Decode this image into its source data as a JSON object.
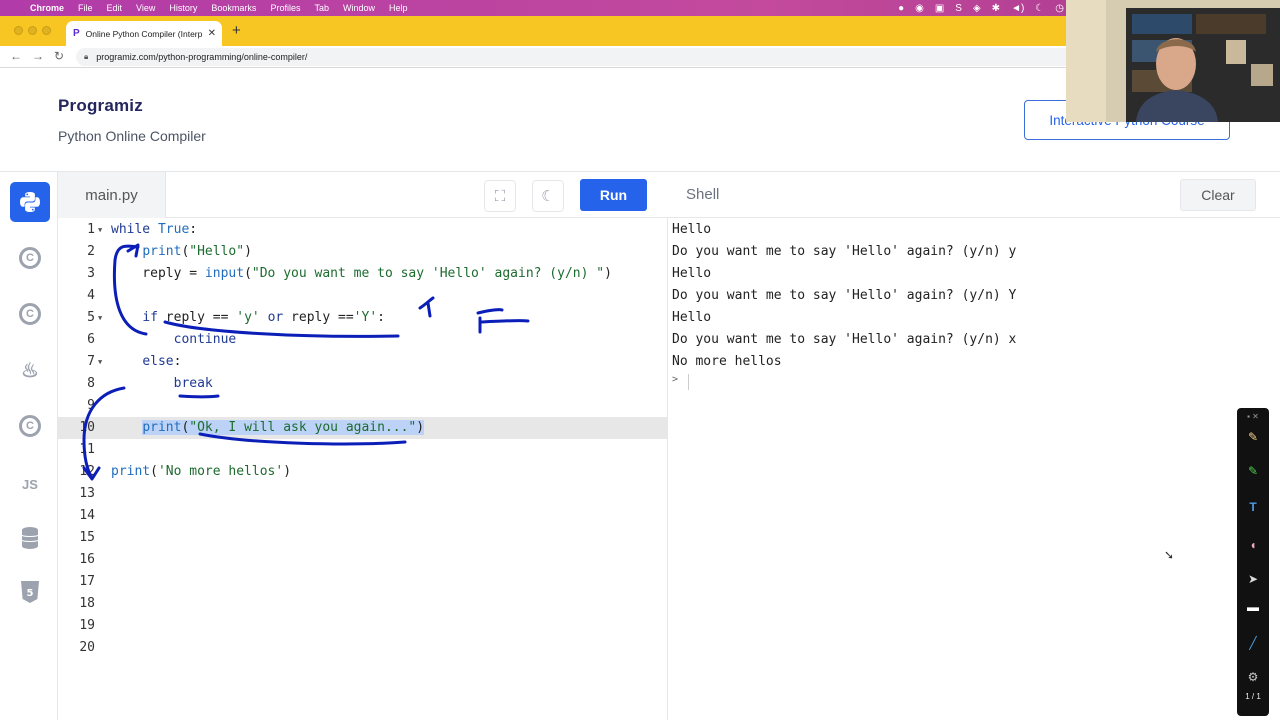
{
  "menubar": {
    "items": [
      "Chrome",
      "File",
      "Edit",
      "View",
      "History",
      "Bookmarks",
      "Profiles",
      "Tab",
      "Window",
      "Help"
    ]
  },
  "browser": {
    "tab_title": "Online Python Compiler (Interp",
    "url": "programiz.com/python-programming/online-compiler/"
  },
  "header": {
    "logo": "Programiz",
    "subtitle": "Python Online Compiler",
    "course_button": "Interactive Python Course"
  },
  "sidebar": {
    "languages": [
      {
        "name": "python-icon",
        "active": true
      },
      {
        "name": "c-icon",
        "label": "C"
      },
      {
        "name": "cpp-icon",
        "label": "C"
      },
      {
        "name": "java-icon",
        "label": "♨"
      },
      {
        "name": "csharp-icon",
        "label": "C"
      },
      {
        "name": "javascript-icon",
        "label": "JS"
      },
      {
        "name": "database-icon"
      },
      {
        "name": "html5-icon",
        "label": "5"
      }
    ]
  },
  "editor": {
    "file_tab": "main.py",
    "run_label": "Run",
    "lines": [
      {
        "n": "1",
        "text": "while True:"
      },
      {
        "n": "2",
        "text": "    print(\"Hello\")"
      },
      {
        "n": "3",
        "text": "    reply = input(\"Do you want me to say 'Hello' again? (y/n) \")"
      },
      {
        "n": "4",
        "text": ""
      },
      {
        "n": "5",
        "text": "    if reply == 'y' or reply =='Y':"
      },
      {
        "n": "6",
        "text": "        continue"
      },
      {
        "n": "7",
        "text": "    else:"
      },
      {
        "n": "8",
        "text": "        break"
      },
      {
        "n": "9",
        "text": ""
      },
      {
        "n": "10",
        "text": "    print(\"Ok, I will ask you again...\")"
      },
      {
        "n": "11",
        "text": ""
      },
      {
        "n": "12",
        "text": "print('No more hellos')"
      },
      {
        "n": "13",
        "text": ""
      },
      {
        "n": "14",
        "text": ""
      },
      {
        "n": "15",
        "text": ""
      },
      {
        "n": "16",
        "text": ""
      },
      {
        "n": "17",
        "text": ""
      },
      {
        "n": "18",
        "text": ""
      },
      {
        "n": "19",
        "text": ""
      },
      {
        "n": "20",
        "text": ""
      }
    ]
  },
  "shell": {
    "title": "Shell",
    "clear_label": "Clear",
    "output": [
      "Hello",
      "Do you want me to say 'Hello' again? (y/n) y",
      "Hello",
      "Do you want me to say 'Hello' again? (y/n) Y",
      "Hello",
      "Do you want me to say 'Hello' again? (y/n) x",
      "No more hellos"
    ],
    "prompt": ">"
  },
  "drawing_toolbar": {
    "page_indicator": "1 / 1"
  },
  "colors": {
    "accent": "#2563eb",
    "annotation_ink": "#0b1fb8",
    "tab_bar": "#f7c623"
  }
}
